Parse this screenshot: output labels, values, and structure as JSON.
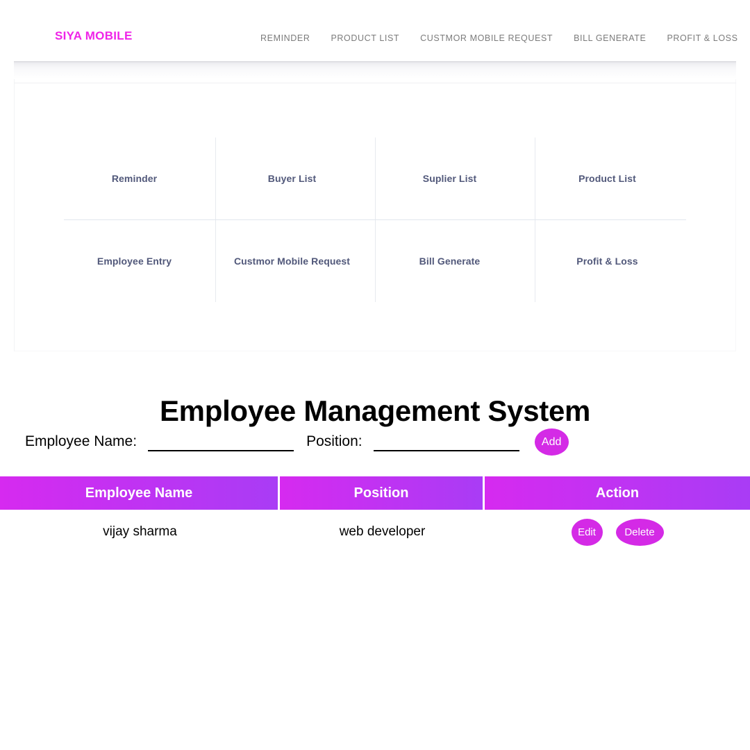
{
  "navbar": {
    "brand": "SIYA MOBILE",
    "links": [
      {
        "label": "REMINDER"
      },
      {
        "label": "PRODUCT LIST"
      },
      {
        "label": "CUSTMOR MOBILE REQUEST"
      },
      {
        "label": "BILL GENERATE"
      },
      {
        "label": "PROFIT & LOSS"
      }
    ]
  },
  "shortcut_grid": {
    "items": [
      {
        "label": "Reminder"
      },
      {
        "label": "Buyer List"
      },
      {
        "label": "Suplier List"
      },
      {
        "label": "Product List"
      },
      {
        "label": "Employee Entry"
      },
      {
        "label": "Custmor Mobile Request"
      },
      {
        "label": "Bill Generate"
      },
      {
        "label": "Profit & Loss"
      }
    ]
  },
  "page_title": "Employee Management System",
  "form": {
    "name_label": "Employee Name:",
    "name_value": "",
    "name_placeholder": "",
    "position_label": "Position:",
    "position_value": "",
    "position_placeholder": "",
    "add_label": "Add"
  },
  "table": {
    "columns": [
      "Employee Name",
      "Position",
      "Action"
    ],
    "rows": [
      {
        "employee_name": "vijay sharma",
        "position": "web developer",
        "edit_label": "Edit",
        "delete_label": "Delete"
      }
    ]
  },
  "colors": {
    "brand_magenta": "#ef24e8",
    "button_magenta": "#d42ae6",
    "header_gradient_start": "#d62af0",
    "header_gradient_end": "#a93cf5",
    "grid_label": "#51587a",
    "nav_link": "#7b7b7b"
  }
}
